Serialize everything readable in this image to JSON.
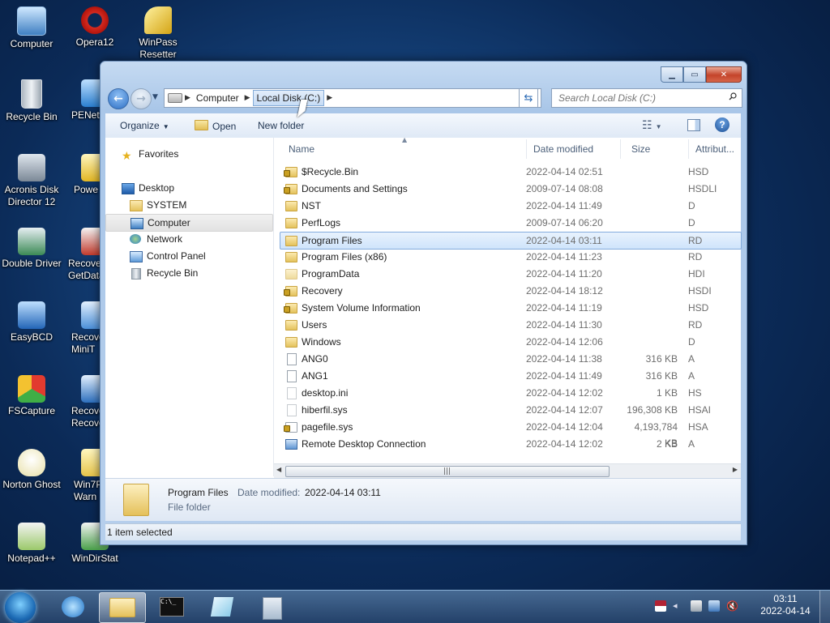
{
  "desktop": {
    "icons_left": [
      {
        "label": "Computer"
      },
      {
        "label": "Recycle Bin"
      },
      {
        "label": "Acronis Disk\nDirector 12"
      },
      {
        "label": "Double Driver"
      },
      {
        "label": "EasyBCD"
      },
      {
        "label": "FSCapture"
      },
      {
        "label": "Norton Ghost"
      },
      {
        "label": "Notepad++"
      }
    ],
    "icons_mid": [
      {
        "label": "Opera12"
      },
      {
        "label": "PENetw"
      },
      {
        "label": "Powe"
      },
      {
        "label": "Recove\nGetData"
      },
      {
        "label": "Recove\nMiniT"
      },
      {
        "label": "Recove\nRecove"
      },
      {
        "label": "Win7P\nWarn"
      },
      {
        "label": "WinDirStat"
      }
    ],
    "icon_winpass": {
      "label": "WinPass\nResetter"
    }
  },
  "window": {
    "address": {
      "crumb1": "Computer",
      "crumb2": "Local Disk (C:)"
    },
    "search_placeholder": "Search Local Disk (C:)",
    "toolbar": {
      "organize": "Organize",
      "open": "Open",
      "new_folder": "New folder"
    },
    "nav": [
      {
        "label": "Favorites",
        "icon": "star-icon"
      },
      {
        "label": "Desktop",
        "icon": "desktop-icon"
      },
      {
        "label": "SYSTEM",
        "icon": "user-folder-icon"
      },
      {
        "label": "Computer",
        "icon": "computer-icon"
      },
      {
        "label": "Network",
        "icon": "network-icon"
      },
      {
        "label": "Control Panel",
        "icon": "control-panel-icon"
      },
      {
        "label": "Recycle Bin",
        "icon": "recycle-bin-icon"
      }
    ],
    "columns": {
      "name": "Name",
      "date": "Date modified",
      "size": "Size",
      "attr": "Attribut..."
    },
    "files": [
      {
        "name": "$Recycle.Bin",
        "date": "2022-04-14 02:51",
        "size": "",
        "attr": "HSD"
      },
      {
        "name": "Documents and Settings",
        "date": "2009-07-14 08:08",
        "size": "",
        "attr": "HSDLI"
      },
      {
        "name": "NST",
        "date": "2022-04-14 11:49",
        "size": "",
        "attr": "D"
      },
      {
        "name": "PerfLogs",
        "date": "2009-07-14 06:20",
        "size": "",
        "attr": "D"
      },
      {
        "name": "Program Files",
        "date": "2022-04-14 03:11",
        "size": "",
        "attr": "RD"
      },
      {
        "name": "Program Files (x86)",
        "date": "2022-04-14 11:23",
        "size": "",
        "attr": "RD"
      },
      {
        "name": "ProgramData",
        "date": "2022-04-14 11:20",
        "size": "",
        "attr": "HDI"
      },
      {
        "name": "Recovery",
        "date": "2022-04-14 18:12",
        "size": "",
        "attr": "HSDI"
      },
      {
        "name": "System Volume Information",
        "date": "2022-04-14 11:19",
        "size": "",
        "attr": "HSD"
      },
      {
        "name": "Users",
        "date": "2022-04-14 11:30",
        "size": "",
        "attr": "RD"
      },
      {
        "name": "Windows",
        "date": "2022-04-14 12:06",
        "size": "",
        "attr": "D"
      },
      {
        "name": "ANG0",
        "date": "2022-04-14 11:38",
        "size": "316 KB",
        "attr": "A"
      },
      {
        "name": "ANG1",
        "date": "2022-04-14 11:49",
        "size": "316 KB",
        "attr": "A"
      },
      {
        "name": "desktop.ini",
        "date": "2022-04-14 12:02",
        "size": "1 KB",
        "attr": "HS"
      },
      {
        "name": "hiberfil.sys",
        "date": "2022-04-14 12:07",
        "size": "196,308 KB",
        "attr": "HSAI"
      },
      {
        "name": "pagefile.sys",
        "date": "2022-04-14 12:04",
        "size": "4,193,784 KB",
        "attr": "HSA"
      },
      {
        "name": "Remote Desktop Connection",
        "date": "2022-04-14 12:02",
        "size": "2 KB",
        "attr": "A"
      }
    ],
    "details": {
      "name": "Program Files",
      "date_label": "Date modified:",
      "date": "2022-04-14 03:11",
      "type": "File folder"
    },
    "status": "1 item selected"
  },
  "taskbar": {
    "time": "03:11",
    "date": "2022-04-14"
  }
}
